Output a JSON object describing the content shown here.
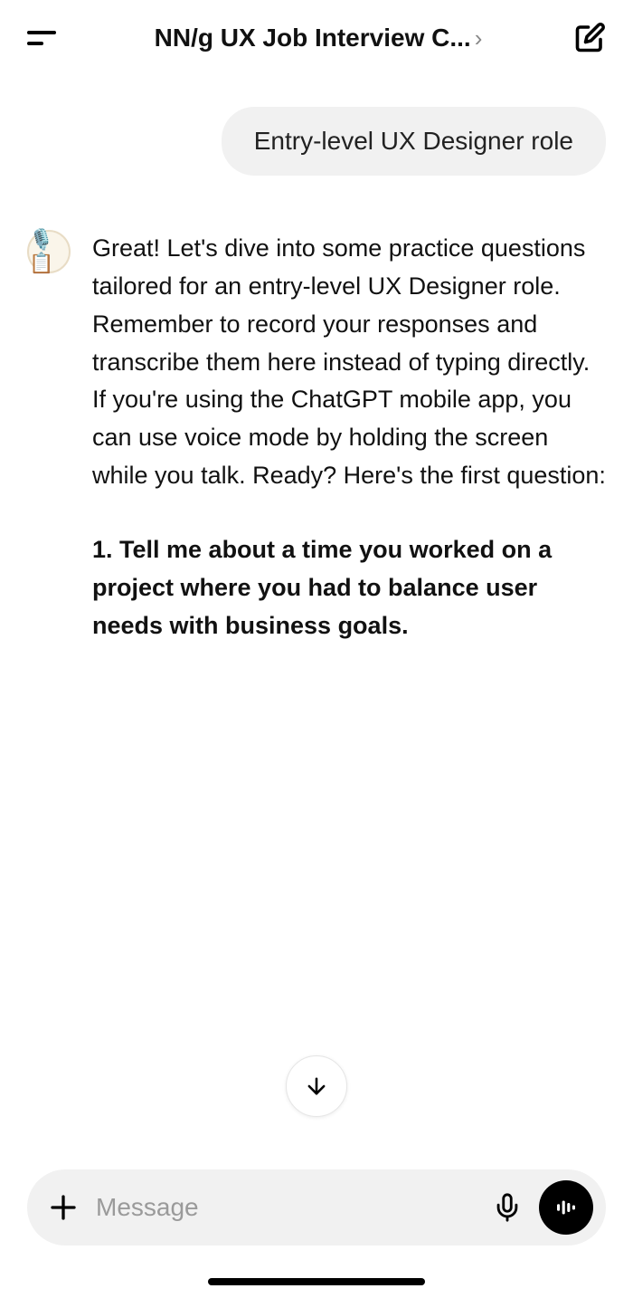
{
  "header": {
    "title": "NN/g UX Job Interview C...",
    "chevron": "›"
  },
  "conversation": {
    "user_message": "Entry-level UX Designer role",
    "assistant": {
      "avatar_glyph": "🎙️📋",
      "paragraph": "Great! Let's dive into some practice questions tailored for an entry-level UX Designer role. Remember to record your responses and transcribe them here instead of typing directly. If you're using the ChatGPT mobile app, you can use voice mode by holding the screen while you talk. Ready? Here's the first question:",
      "question": "1. Tell me about a time you worked on a project where you had to balance user needs with business goals."
    }
  },
  "composer": {
    "placeholder": "Message"
  }
}
